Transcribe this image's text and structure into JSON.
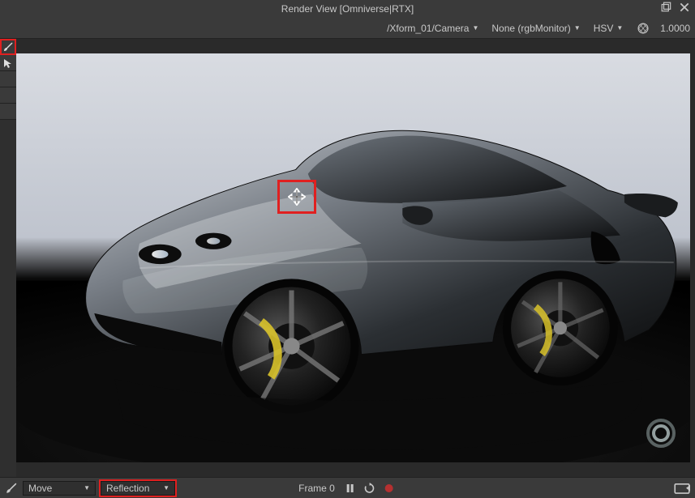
{
  "titlebar": {
    "title": "Render View  [Omniverse|RTX]"
  },
  "header": {
    "camera_path": "/Xform_01/Camera",
    "monitor": "None (rgbMonitor)",
    "color_mode": "HSV",
    "shutter_value": "1.0000"
  },
  "toolbox": {
    "tool0_name": "brush-tool",
    "tool1_name": "cursor-tool"
  },
  "cursor": {
    "mode": "move"
  },
  "bottombar": {
    "transform_mode": "Move",
    "render_mode": "Reflection",
    "frame_label": "Frame 0"
  }
}
